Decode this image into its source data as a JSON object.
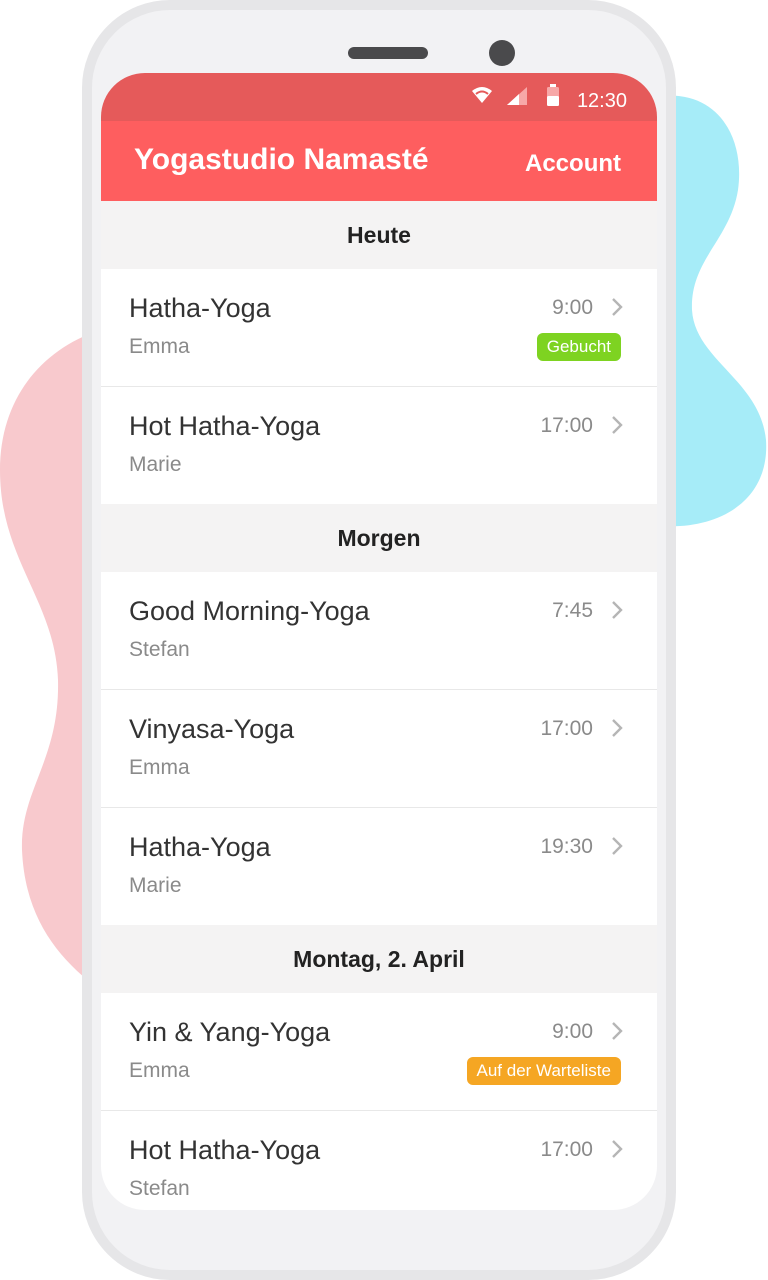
{
  "colors": {
    "appbar": "#fe5e5f",
    "statusbar": "#e55a5a",
    "booked_badge": "#7ed321",
    "waitlist_badge": "#f5a623",
    "blob_pink": "#f8c9cd",
    "blob_cyan": "#a6ecf8"
  },
  "statusbar": {
    "time": "12:30",
    "icons": [
      "wifi-icon",
      "signal-icon",
      "battery-icon"
    ]
  },
  "appbar": {
    "title": "Yogastudio Namasté",
    "account_label": "Account"
  },
  "sections": [
    {
      "header": "Heute",
      "classes": [
        {
          "name": "Hatha-Yoga",
          "teacher": "Emma",
          "time": "9:00",
          "badge": "Gebucht"
        },
        {
          "name": "Hot Hatha-Yoga",
          "teacher": "Marie",
          "time": "17:00"
        }
      ]
    },
    {
      "header": "Morgen",
      "classes": [
        {
          "name": "Good Morning-Yoga",
          "teacher": "Stefan",
          "time": "7:45"
        },
        {
          "name": "Vinyasa-Yoga",
          "teacher": "Emma",
          "time": "17:00"
        },
        {
          "name": "Hatha-Yoga",
          "teacher": "Marie",
          "time": "19:30"
        }
      ]
    },
    {
      "header": "Montag, 2. April",
      "classes": [
        {
          "name": "Yin & Yang-Yoga",
          "teacher": "Emma",
          "time": "9:00",
          "badge": "Auf der Warteliste"
        },
        {
          "name": "Hot Hatha-Yoga",
          "teacher": "Stefan",
          "time": "17:00"
        }
      ]
    }
  ]
}
